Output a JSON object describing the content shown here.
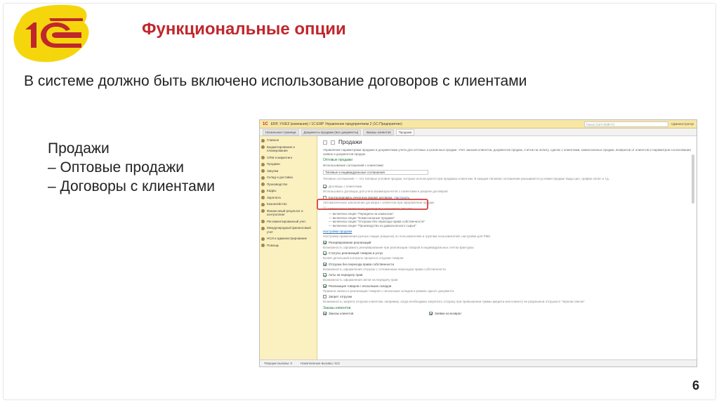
{
  "slide": {
    "title": "Функциональные опции",
    "subtitle": "В системе должно быть включено использование договоров с клиентами",
    "left_list": [
      "Продажи",
      "– Оптовые продажи",
      "– Договоры с клиентами"
    ],
    "page_number": "6",
    "logo_text": "1С"
  },
  "window": {
    "title": "ERP, УХ/ЕЗ (компания) / 1С:ERP Управление предприятием 2 (1С:Предприятие)",
    "search_placeholder": "Поиск (Ctrl+Shift+F)",
    "user": "Администратор",
    "tabs": [
      "Начальная страница",
      "Документы продажи (все документы)",
      "Заказы клиентов",
      "Продажи"
    ],
    "active_tab": "Продажи",
    "sidebar": [
      "Главное",
      "Бюджетирование и планирование",
      "CRM и маркетинг",
      "Продажи",
      "Закупки",
      "Склад и доставка",
      "Производство",
      "Кадры",
      "Зарплата",
      "Казначейство",
      "Финансовый результат и контроллинг",
      "Регламентированный учет",
      "Международный финансовый учет",
      "НСИ и администрирование",
      "Помощь"
    ],
    "content": {
      "heading": "Продажи",
      "description": "Управление параметрами продажи и документами учета для оптовых и розничных продаж. Учет заказов клиентов, документов продаж, счетов на оплату, сделок с клиентами, комиссионных продаж, возвратов от клиентов и параметров согласования заявок и документов продаж.",
      "group_wholesale": "Оптовые продажи",
      "agreements_label": "Использование соглашений с клиентами:",
      "agreements_value": "Типовые и индивидуальные соглашения",
      "agreements_note": "Типовые соглашения — это типовые условия продаж, которые используются при продажах клиентам. В каждом типовом соглашении указываются условия продаж: виды цен, график оплат и т.д.",
      "contracts_label": "Договоры с клиентами",
      "contracts_note": "Использовать договоры для учета взаиморасчетов с клиентами в разрезе договоров",
      "contract_check_label": "Контролировать печатную форму договора",
      "contract_check_link": "Настроить",
      "contract_auto": "Автоматическое заполнение договора с клиентом при оформлении продаж",
      "contract_info": "Невозможно отключение договоров с клиентами, так как:",
      "contract_reasons": [
        "— включена опция \"Передача на комиссию\"",
        "— включена опция \"Комиссионные продажи\"",
        "— включена опция \"Отгрузки без перехода права собственности\"",
        "— включена опция \"Производство из давальческого сырья\""
      ],
      "sales_settings_link": "Настройки продажи",
      "sales_settings_note": "Настройка применения ручных скидок (наценок) по пользователям и группам пользователей, настройки для РМК.",
      "options": [
        {
          "label": "Резервирование реализаций",
          "checked": true,
          "note": "Возможность оформить резервирование при реализации товаров в индивидуальных счетах-фактурах"
        },
        {
          "label": "Статусы реализаций товаров и услуг",
          "checked": true,
          "note": "Более детальный контроль процесса отгрузки товаров"
        },
        {
          "label": "Отгрузка без перехода права собственности",
          "checked": true,
          "note": "Возможность оформления отгрузок с отложенным переходом права собственности"
        },
        {
          "label": "Акты на передачу прав",
          "checked": true,
          "note": "Возможность оформления актов на передачу прав"
        },
        {
          "label": "Реализация товаров с нескольких складов",
          "checked": true,
          "note": "Правила записи и реализации товаров с нескольких складов в рамках одного документа"
        },
        {
          "label": "Запрет отгрузки",
          "checked": false,
          "note": "Возможность запрета отгрузки клиентам, например, когда необходимо запретить отгрузку при превышении суммы кредита или клиенту не разрешена отгрузка в \"черном списке\""
        }
      ],
      "orders_group": "Заказы клиентов",
      "orders_left": "Заказы клиентов",
      "orders_right": "Заявки на возврат"
    },
    "status": [
      "Текущие вызовы: 0",
      "Накопленные вызовы: 413"
    ]
  },
  "colors": {
    "title_red": "#c0272d",
    "logo_yellow": "#f5d60c",
    "highlight_red": "#d9534f",
    "sidebar_bg": "#fbf0c0",
    "group_green": "#2a7c3f"
  }
}
